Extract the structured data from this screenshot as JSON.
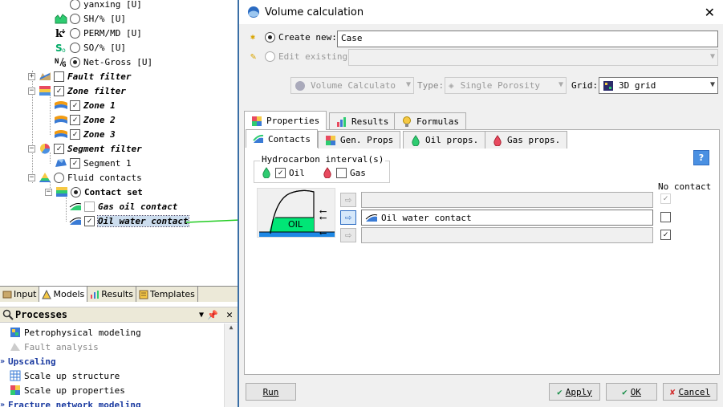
{
  "tree": {
    "properties": [
      {
        "label": "yanxing [U]"
      },
      {
        "label": "SH/% [U]"
      },
      {
        "label": "PERM/MD [U]"
      },
      {
        "label": "SO/% [U]"
      },
      {
        "label": "Net-Gross [U]"
      }
    ],
    "fault_filter": "Fault filter",
    "zone_filter": "Zone filter",
    "zones": [
      "Zone 1",
      "Zone 2",
      "Zone 3"
    ],
    "segment_filter": "Segment filter",
    "segment": "Segment 1",
    "fluid_contacts": "Fluid contacts",
    "contact_set": "Contact set",
    "gas_oil_contact": "Gas oil contact",
    "oil_water_contact": "Oil water contact"
  },
  "bottom_tabs": [
    "Input",
    "Models",
    "Results",
    "Templates"
  ],
  "processes": {
    "header": "Processes",
    "items": [
      {
        "label": "Petrophysical modeling"
      },
      {
        "label": "Fault analysis"
      }
    ],
    "upscaling": "Upscaling",
    "upscaling_items": [
      "Scale up structure",
      "Scale up properties"
    ],
    "fracture": "Fracture network modeling"
  },
  "dialog": {
    "title": "Volume calculation",
    "create_new_label": "Create new:",
    "create_new_value": "Case",
    "edit_existing_label": "Edit existing:",
    "vol_calc_value": "Volume Calculato",
    "type_label": "Type:",
    "type_value": "Single Porosity",
    "grid_label": "Grid:",
    "grid_value": "3D grid",
    "tabs": [
      "Properties",
      "Results",
      "Formulas"
    ],
    "subtabs": [
      "Contacts",
      "Gen. Props",
      "Oil props.",
      "Gas props."
    ],
    "hc_group_label": "Hydrocarbon interval(s)",
    "oil_label": "Oil",
    "gas_label": "Gas",
    "oil_diagram_label": "OIL",
    "no_contact_label": "No contact",
    "contact_middle": "Oil water contact",
    "help_symbol": "?",
    "buttons": {
      "run": "Run",
      "apply": "Apply",
      "ok": "OK",
      "cancel": "Cancel"
    }
  },
  "colors": {
    "accent": "#3a6ea5",
    "oil_fill": "#00e676",
    "water_fill": "#1e88e5",
    "guide_arrow": "#22cc22"
  }
}
